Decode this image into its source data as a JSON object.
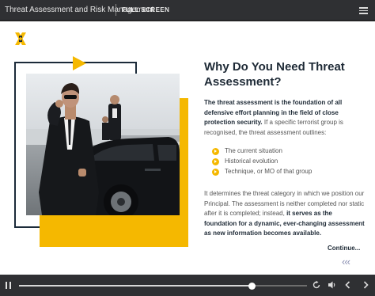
{
  "header": {
    "course_title": "Threat Assessment and Risk Management",
    "fullscreen_label": "FULL SCREEN",
    "menu_icon": "hamburger-menu-icon"
  },
  "slide": {
    "logo_icon": "x-logo-icon",
    "heading": "Why Do You Need Threat Assessment?",
    "intro_bold": "The threat assessment is the foundation of all defensive effort planning in the field of close protection security.",
    "intro_rest": " If a specific terrorist group is recognised, the threat assessment outlines:",
    "bullets": [
      "The current situation",
      "Historical evolution",
      "Technique, or MO of that group"
    ],
    "para2_a": "It determines the threat category in which we position our Principal. The assessment is neither completed nor static after it is completed; instead, ",
    "para2_bold": "it serves as the foundation for a dynamic, ever-changing assessment as new information becomes available.",
    "continue_label": "Continue...",
    "back_chevrons": "‹‹‹",
    "colors": {
      "accent": "#f5b800",
      "navy": "#1c2b3a",
      "text": "#555555"
    }
  },
  "player": {
    "progress": 0.81,
    "icons": [
      "pause-icon",
      "replay-icon",
      "volume-icon",
      "previous-icon",
      "next-icon"
    ]
  }
}
